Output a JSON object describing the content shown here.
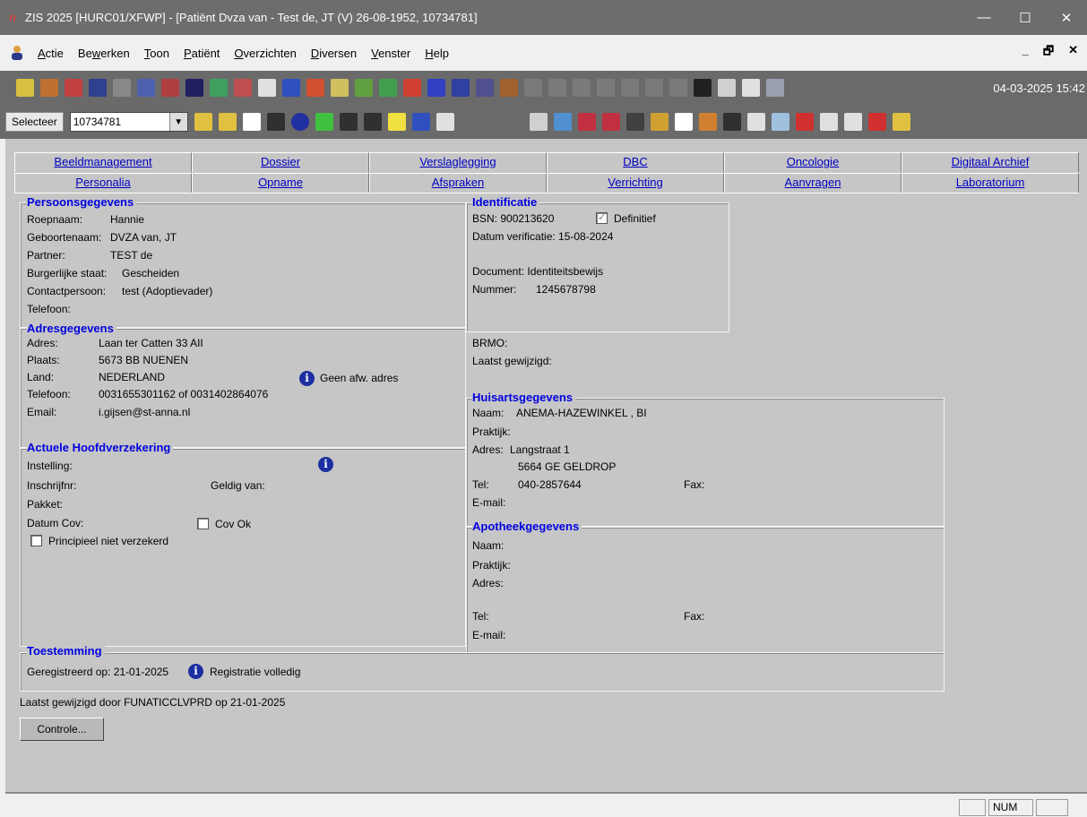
{
  "window": {
    "title": "ZIS 2025 [HURC01/XFWP] - [Patiënt Dvza van - Test de, JT (V) 26-08-1952, 10734781]",
    "logo": "n",
    "controls": {
      "minimize": "—",
      "maximize": "☐",
      "close": "✕"
    }
  },
  "menu": {
    "items": [
      {
        "pre": "",
        "u": "A",
        "post": "ctie"
      },
      {
        "pre": "Be",
        "u": "w",
        "post": "erken"
      },
      {
        "pre": "",
        "u": "T",
        "post": "oon"
      },
      {
        "pre": "",
        "u": "P",
        "post": "atiënt"
      },
      {
        "pre": "",
        "u": "O",
        "post": "verzichten"
      },
      {
        "pre": "",
        "u": "D",
        "post": "iversen"
      },
      {
        "pre": "",
        "u": "V",
        "post": "enster"
      },
      {
        "pre": "",
        "u": "H",
        "post": "elp"
      }
    ],
    "mdi_min": "_",
    "mdi_restore": "🗗",
    "mdi_close": "✕"
  },
  "toolbar1": {
    "datetime": "04-03-2025 15:42"
  },
  "toolbar2": {
    "select_label": "Selecteer",
    "select_value": "10734781"
  },
  "tabs": {
    "row1": [
      "Beeldmanagement",
      "Dossier",
      "Verslaglegging",
      "DBC",
      "Oncologie",
      "Digitaal Archief"
    ],
    "row2": [
      "Personalia",
      "Opname",
      "Afspraken",
      "Verrichting",
      "Aanvragen",
      "Laboratorium"
    ]
  },
  "persoon": {
    "title": "Persoonsgegevens",
    "roepnaam_label": "Roepnaam:",
    "roepnaam": "Hannie",
    "geboortenaam_label": "Geboortenaam:",
    "geboortenaam": "DVZA van, JT",
    "partner_label": "Partner:",
    "partner": "TEST de",
    "staat_label": "Burgerlijke staat:",
    "staat": "Gescheiden",
    "contact_label": "Contactpersoon:",
    "contact": "test (Adoptievader)",
    "telefoon_label": "Telefoon:"
  },
  "adres": {
    "title": "Adresgegevens",
    "adres_label": "Adres:",
    "adres": "Laan ter Catten 33 AII",
    "plaats_label": "Plaats:",
    "plaats": "5673 BB  NUENEN",
    "land_label": "Land:",
    "land": "NEDERLAND",
    "afw": "Geen afw. adres",
    "telefoon_label": "Telefoon:",
    "telefoon": "0031655301162 of 0031402864076",
    "email_label": "Email:",
    "email": "i.gijsen@st-anna.nl"
  },
  "verzekering": {
    "title": "Actuele Hoofdverzekering",
    "instelling_label": "Instelling:",
    "inschrijf_label": "Inschrijfnr:",
    "geldig_label": "Geldig van:",
    "pakket_label": "Pakket:",
    "datumcov_label": "Datum Cov:",
    "covok_label": "Cov Ok",
    "principieel_label": "Principieel niet verzekerd"
  },
  "identificatie": {
    "title": "Identificatie",
    "bsn": "BSN: 900213620",
    "definitief": "Definitief",
    "verificatie": "Datum verificatie:  15-08-2024",
    "document": "Document: Identiteitsbewijs",
    "nummer_label": "Nummer:",
    "nummer": "1245678798"
  },
  "brmo": {
    "label": "BRMO:",
    "laatst": "Laatst gewijzigd:"
  },
  "huisarts": {
    "title": "Huisartsgegevens",
    "naam_label": "Naam:",
    "naam": "ANEMA-HAZEWINKEL , BI",
    "praktijk_label": "Praktijk:",
    "adres_label": "Adres:",
    "adres1": "Langstraat 1",
    "adres2": "5664 GE GELDROP",
    "tel_label": "Tel:",
    "tel": "040-2857644",
    "fax_label": "Fax:",
    "email_label": "E-mail:"
  },
  "apotheek": {
    "title": "Apotheekgegevens",
    "naam_label": "Naam:",
    "praktijk_label": "Praktijk:",
    "adres_label": "Adres:",
    "tel_label": "Tel:",
    "fax_label": "Fax:",
    "email_label": "E-mail:"
  },
  "toestemming": {
    "title": "Toestemming",
    "geregistreerd": "Geregistreerd op:  21-01-2025",
    "status": "Registratie volledig"
  },
  "footer": {
    "laatst": "Laatst gewijzigd door FUNATICCLVPRD op 21-01-2025",
    "controle": "Controle..."
  },
  "statusbar": {
    "num": "NUM"
  },
  "colors": {
    "titlebar": "#6d6d6d",
    "toolbar": "#6a6a6a",
    "panel": "#c6c6c6",
    "group_title": "#0000e0",
    "tab_text": "#0000c0",
    "info_icon": "#1c2fa0"
  }
}
